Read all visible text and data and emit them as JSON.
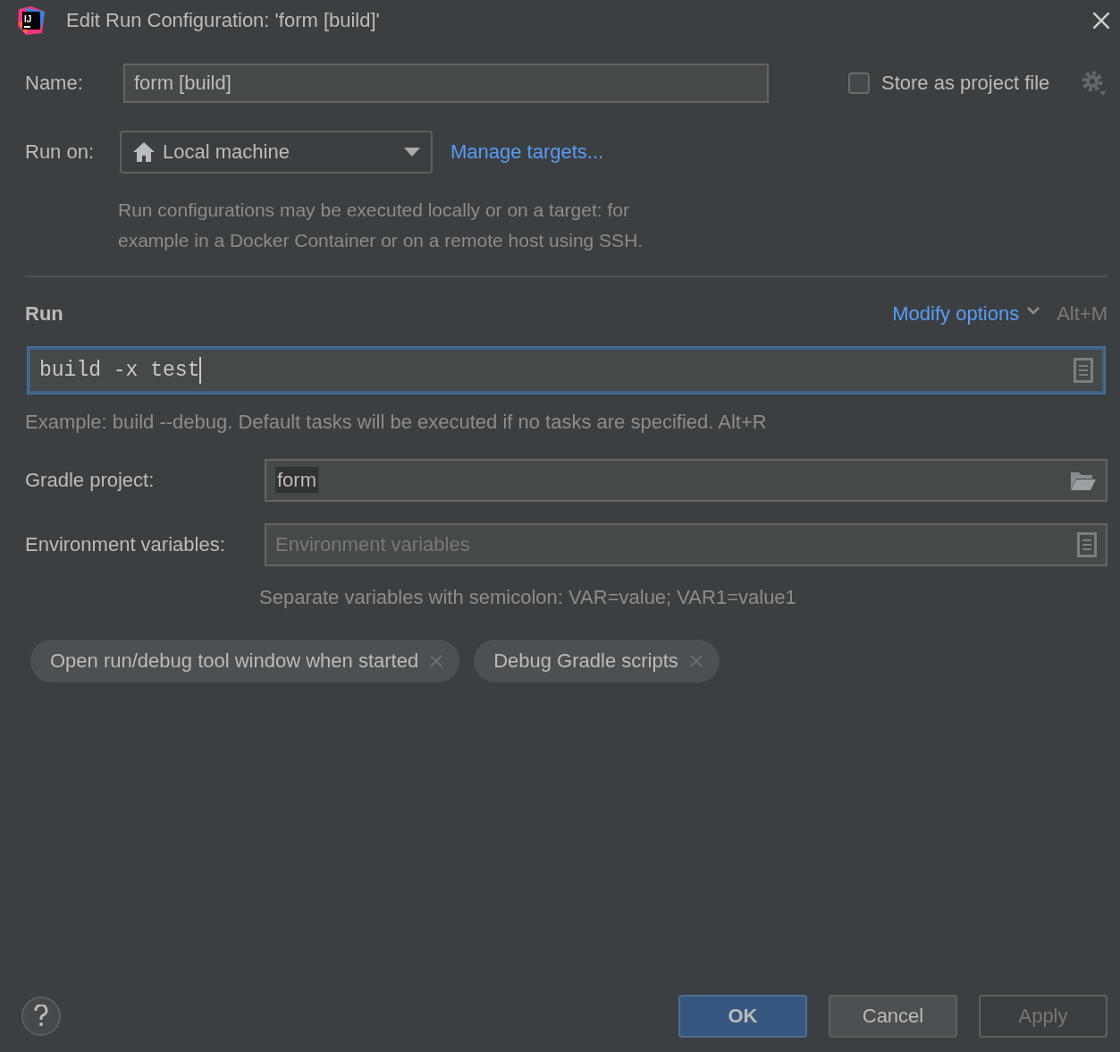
{
  "window": {
    "logo_text": "IJ",
    "title": "Edit Run Configuration: 'form [build]'"
  },
  "name": {
    "label": "Name:",
    "value": "form [build]"
  },
  "store_as_project_file": {
    "label": "Store as project file",
    "checked": false
  },
  "run_on": {
    "label": "Run on:",
    "value": "Local machine",
    "link": "Manage targets...",
    "help_lines": [
      "Run configurations may be executed locally or on a target: for",
      "example in a Docker Container or on a remote host using SSH."
    ]
  },
  "run_section": {
    "title": "Run",
    "modify_options": "Modify options",
    "shortcut": "Alt+M",
    "tasks": {
      "value": "build -x test",
      "focused": true
    },
    "hint": "Example: build --debug. Default tasks will be executed if no tasks are specified. Alt+R"
  },
  "fields": [
    {
      "label": "Gradle project:",
      "value": "form",
      "kind": "folder"
    },
    {
      "label": "Environment variables:",
      "placeholder": "Environment variables",
      "kind": "document"
    }
  ],
  "env_hint": "Separate variables with semicolon: VAR=value; VAR1=value1",
  "options": [
    {
      "label": "Open run/debug tool window when started"
    },
    {
      "label": "Debug Gradle scripts"
    }
  ],
  "buttons": [
    {
      "label": "OK",
      "kind": "default",
      "disabled": false
    },
    {
      "label": "Cancel",
      "kind": "normal",
      "disabled": false
    },
    {
      "label": "Apply",
      "kind": "normal",
      "disabled": true
    }
  ]
}
